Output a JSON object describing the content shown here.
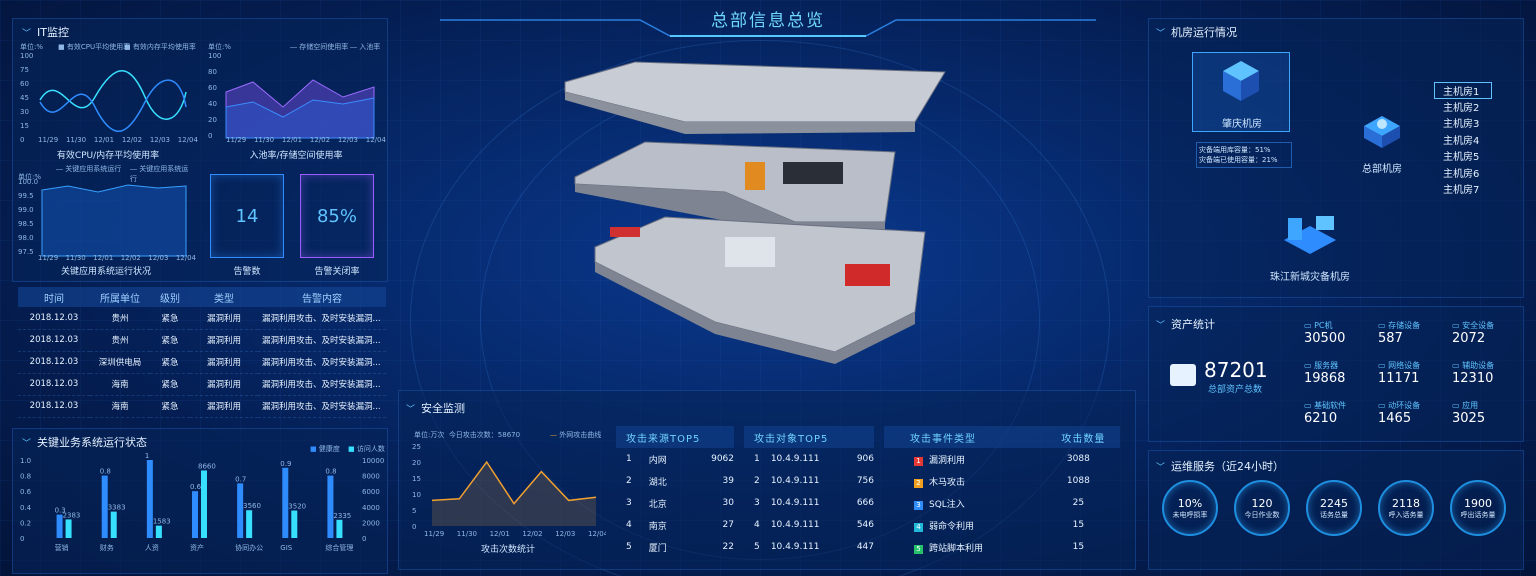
{
  "header": {
    "title": "总部信息总览"
  },
  "it_monitor": {
    "title": "IT监控",
    "cpu_chart": {
      "unit": "单位:%",
      "legend": [
        "有效CPU平均使用率",
        "有效内存平均使用率"
      ],
      "caption": "有效CPU/内存平均使用率",
      "yticks": [
        "100",
        "75",
        "60",
        "45",
        "30",
        "15",
        "0"
      ],
      "xticks": [
        "11/29",
        "11/30",
        "12/01",
        "12/02",
        "12/03",
        "12/04"
      ]
    },
    "pool_chart": {
      "unit": "单位:%",
      "legend": [
        "存储空间使用率",
        "入池率"
      ],
      "caption": "入池率/存储空间使用率",
      "yticks": [
        "100",
        "80",
        "60",
        "40",
        "20",
        "0"
      ],
      "xticks": [
        "11/29",
        "11/30",
        "12/01",
        "12/02",
        "12/03",
        "12/04"
      ]
    },
    "sys_chart": {
      "unit": "单位:%",
      "legend": [
        "关键应用系统运行",
        "关键应用系统运行"
      ],
      "caption": "关键应用系统运行状况",
      "yticks": [
        "100.0",
        "99.5",
        "99.0",
        "98.5",
        "98.0",
        "97.5"
      ],
      "xticks": [
        "11/29",
        "11/30",
        "12/01",
        "12/02",
        "12/03",
        "12/04"
      ]
    },
    "alarm_count": {
      "value": "14",
      "label": "告警数"
    },
    "alarm_close_rate": {
      "value": "85%",
      "label": "告警关闭率"
    }
  },
  "alarm_table": {
    "headers": [
      "时间",
      "所属单位",
      "级别",
      "类型",
      "告警内容"
    ],
    "rows": [
      [
        "2018.12.03",
        "贵州",
        "紧急",
        "漏洞利用",
        "漏洞利用攻击、及时安装漏洞..."
      ],
      [
        "2018.12.03",
        "贵州",
        "紧急",
        "漏洞利用",
        "漏洞利用攻击、及时安装漏洞..."
      ],
      [
        "2018.12.03",
        "深圳供电局",
        "紧急",
        "漏洞利用",
        "漏洞利用攻击、及时安装漏洞..."
      ],
      [
        "2018.12.03",
        "海南",
        "紧急",
        "漏洞利用",
        "漏洞利用攻击、及时安装漏洞..."
      ],
      [
        "2018.12.03",
        "海南",
        "紧急",
        "漏洞利用",
        "漏洞利用攻击、及时安装漏洞..."
      ]
    ]
  },
  "business": {
    "title": "关键业务系统运行状态",
    "legend": [
      "健康度",
      "访问人数"
    ],
    "yticks_left": [
      "1.0",
      "0.8",
      "0.6",
      "0.4",
      "0.2",
      "0"
    ],
    "yticks_right": [
      "10000",
      "8000",
      "6000",
      "4000",
      "2000",
      "0"
    ]
  },
  "chart_data": [
    {
      "type": "bar",
      "title": "关键业务系统运行状态",
      "categories": [
        "营销",
        "财务",
        "人资",
        "资产",
        "协同办公",
        "GIS",
        "综合管理"
      ],
      "ylim": [
        0,
        1.0
      ],
      "y2lim": [
        0,
        10000
      ],
      "series": [
        {
          "name": "健康度",
          "values": [
            0.3,
            0.8,
            1.0,
            0.6,
            0.7,
            0.9,
            0.8
          ],
          "color": "#2f8cff"
        },
        {
          "name": "访问人数",
          "values": [
            2383,
            3383,
            1583,
            8660,
            3560,
            3520,
            2335
          ],
          "color": "#38e0ff"
        }
      ]
    },
    {
      "type": "line",
      "title": "攻击次数统计",
      "x": [
        "11/29",
        "11/30",
        "12/01",
        "12/02",
        "12/03",
        "12/04"
      ],
      "ylim": [
        0,
        25
      ],
      "series": [
        {
          "name": "外网攻击曲线",
          "values": [
            8,
            8.5,
            20,
            7,
            17,
            8,
            9
          ],
          "color": "#f0a030"
        }
      ]
    }
  ],
  "security": {
    "title": "安全监测",
    "unit": "单位:万次",
    "today_attacks": "今日攻击次数：58670",
    "legend": "外网攻击曲线",
    "caption": "攻击次数统计",
    "yticks": [
      "25",
      "20",
      "15",
      "10",
      "5",
      "0"
    ],
    "xticks": [
      "11/29",
      "11/30",
      "12/01",
      "12/02",
      "12/03",
      "12/04"
    ]
  },
  "attack_source": {
    "header": "攻击来源TOP5",
    "rows": [
      [
        "1",
        "内网",
        "9062"
      ],
      [
        "2",
        "湖北",
        "39"
      ],
      [
        "3",
        "北京",
        "30"
      ],
      [
        "4",
        "南京",
        "27"
      ],
      [
        "5",
        "厦门",
        "22"
      ]
    ]
  },
  "attack_target": {
    "header": "攻击对象TOP5",
    "rows": [
      [
        "1",
        "10.4.9.111",
        "906"
      ],
      [
        "2",
        "10.4.9.111",
        "756"
      ],
      [
        "3",
        "10.4.9.111",
        "666"
      ],
      [
        "4",
        "10.4.9.111",
        "546"
      ],
      [
        "5",
        "10.4.9.111",
        "447"
      ]
    ]
  },
  "attack_event": {
    "headers": [
      "攻击事件类型",
      "攻击数量"
    ],
    "rows": [
      {
        "idx": "1",
        "name": "漏洞利用",
        "count": "3088",
        "color": "#e53935"
      },
      {
        "idx": "2",
        "name": "木马攻击",
        "count": "1088",
        "color": "#f0a020"
      },
      {
        "idx": "3",
        "name": "SQL注入",
        "count": "25",
        "color": "#2f8cff"
      },
      {
        "idx": "4",
        "name": "弱命令利用",
        "count": "15",
        "color": "#22b8d8"
      },
      {
        "idx": "5",
        "name": "跨站脚本利用",
        "count": "15",
        "color": "#26c26b"
      }
    ]
  },
  "machine_room": {
    "title": "机房运行情况",
    "rooms": {
      "zhaoqing": "肇庆机房",
      "hq": "总部机房",
      "zhujiang": "珠江新城灾备机房"
    },
    "disaster_info": [
      "灾备端用库容量：51%",
      "灾备端已使用容量：21%"
    ],
    "list": [
      "主机房1",
      "主机房2",
      "主机房3",
      "主机房4",
      "主机房5",
      "主机房6",
      "主机房7"
    ]
  },
  "assets": {
    "title": "资产统计",
    "total_value": "87201",
    "total_label": "总部资产总数",
    "items": [
      {
        "label": "PC机",
        "value": "30500"
      },
      {
        "label": "存储设备",
        "value": "587"
      },
      {
        "label": "安全设备",
        "value": "2072"
      },
      {
        "label": "服务器",
        "value": "19868"
      },
      {
        "label": "网络设备",
        "value": "11171"
      },
      {
        "label": "辅助设备",
        "value": "12310"
      },
      {
        "label": "基础软件",
        "value": "6210"
      },
      {
        "label": "动环设备",
        "value": "1465"
      },
      {
        "label": "应用",
        "value": "3025"
      }
    ]
  },
  "ops": {
    "title": "运维服务（近24小时）",
    "rings": [
      {
        "value": "10%",
        "label": "未电呼损率"
      },
      {
        "value": "120",
        "label": "今日作业数"
      },
      {
        "value": "2245",
        "label": "话务总量"
      },
      {
        "value": "2118",
        "label": "呼入话务量"
      },
      {
        "value": "1900",
        "label": "呼出话务量"
      }
    ]
  }
}
